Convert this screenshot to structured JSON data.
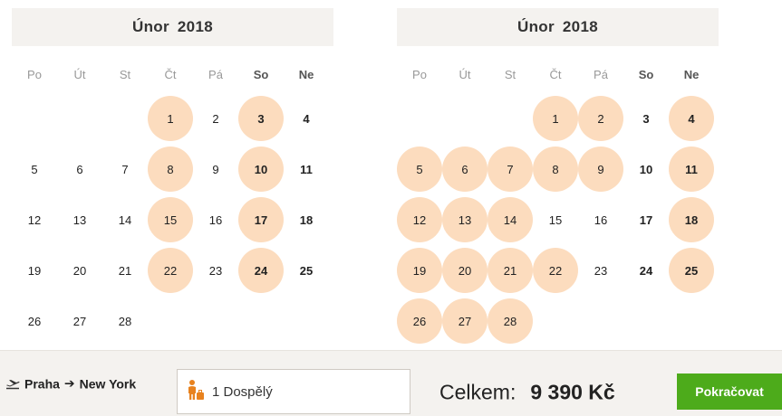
{
  "weekdays": [
    {
      "label": "Po",
      "weekend": false
    },
    {
      "label": "Út",
      "weekend": false
    },
    {
      "label": "St",
      "weekend": false
    },
    {
      "label": "Čt",
      "weekend": false
    },
    {
      "label": "Pá",
      "weekend": false
    },
    {
      "label": "So",
      "weekend": true
    },
    {
      "label": "Ne",
      "weekend": true
    }
  ],
  "calendars": [
    {
      "title": "Únor  2018",
      "days": [
        "",
        "",
        "",
        {
          "d": "1",
          "a": true
        },
        {
          "d": "2"
        },
        {
          "d": "3",
          "a": true
        },
        {
          "d": "4"
        },
        {
          "d": "5"
        },
        {
          "d": "6"
        },
        {
          "d": "7"
        },
        {
          "d": "8",
          "a": true
        },
        {
          "d": "9"
        },
        {
          "d": "10",
          "a": true
        },
        {
          "d": "11"
        },
        {
          "d": "12"
        },
        {
          "d": "13"
        },
        {
          "d": "14"
        },
        {
          "d": "15",
          "a": true
        },
        {
          "d": "16"
        },
        {
          "d": "17",
          "a": true
        },
        {
          "d": "18"
        },
        {
          "d": "19"
        },
        {
          "d": "20"
        },
        {
          "d": "21"
        },
        {
          "d": "22",
          "a": true
        },
        {
          "d": "23"
        },
        {
          "d": "24",
          "a": true
        },
        {
          "d": "25"
        },
        {
          "d": "26"
        },
        {
          "d": "27"
        },
        {
          "d": "28"
        }
      ]
    },
    {
      "title": "Únor  2018",
      "days": [
        "",
        "",
        "",
        {
          "d": "1",
          "a": true
        },
        {
          "d": "2",
          "a": true
        },
        {
          "d": "3"
        },
        {
          "d": "4",
          "a": true
        },
        {
          "d": "5",
          "a": true
        },
        {
          "d": "6",
          "a": true
        },
        {
          "d": "7",
          "a": true
        },
        {
          "d": "8",
          "a": true
        },
        {
          "d": "9",
          "a": true
        },
        {
          "d": "10"
        },
        {
          "d": "11",
          "a": true
        },
        {
          "d": "12",
          "a": true
        },
        {
          "d": "13",
          "a": true
        },
        {
          "d": "14",
          "a": true
        },
        {
          "d": "15"
        },
        {
          "d": "16"
        },
        {
          "d": "17"
        },
        {
          "d": "18",
          "a": true
        },
        {
          "d": "19",
          "a": true
        },
        {
          "d": "20",
          "a": true
        },
        {
          "d": "21",
          "a": true
        },
        {
          "d": "22",
          "a": true
        },
        {
          "d": "23"
        },
        {
          "d": "24"
        },
        {
          "d": "25",
          "a": true
        },
        {
          "d": "26",
          "a": true
        },
        {
          "d": "27",
          "a": true
        },
        {
          "d": "28",
          "a": true
        }
      ]
    }
  ],
  "route": {
    "from": "Praha",
    "arrow": "➔",
    "to": "New York",
    "icon": "plane-takeoff-icon"
  },
  "passengers": {
    "label": "1 Dospělý",
    "icon": "person-luggage-icon"
  },
  "total": {
    "label": "Celkem:",
    "price": "9 390 Kč"
  },
  "continue_label": "Pokračovat",
  "colors": {
    "available": "#fcdcbe",
    "accent_green": "#4dab1b",
    "header_bg": "#f4f2ef"
  }
}
